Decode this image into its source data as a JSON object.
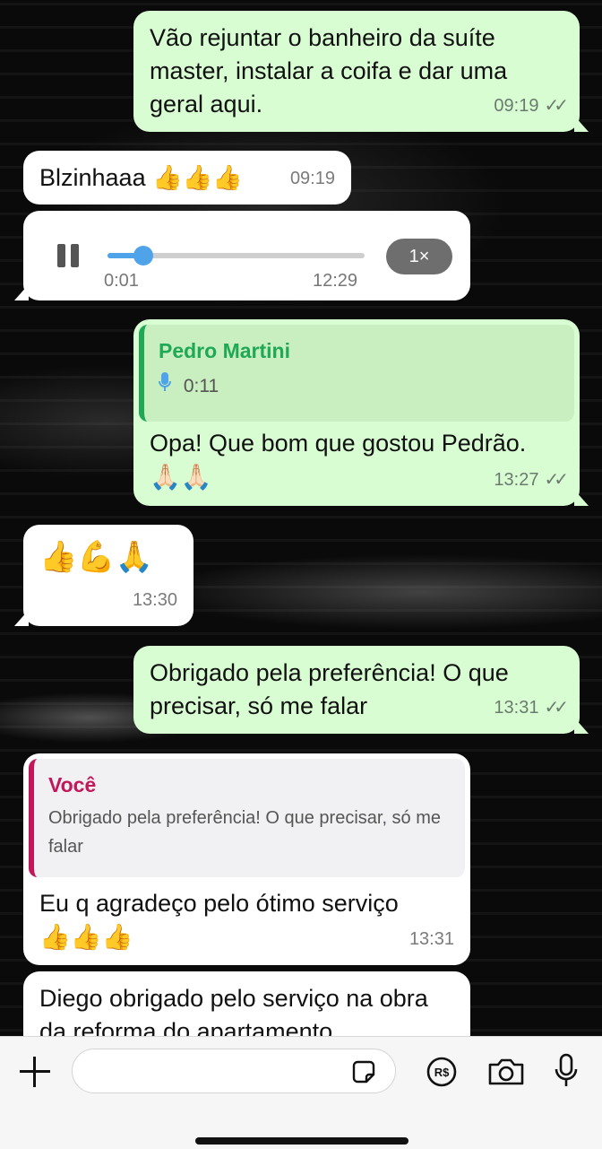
{
  "messages": {
    "m1": {
      "text": "Vão rejuntar o banheiro da suíte master, instalar a coifa e dar uma geral aqui.",
      "time": "09:19"
    },
    "m2": {
      "text": "Blzinhaaa 👍👍👍",
      "time": "09:19"
    },
    "m3": {
      "current": "0:01",
      "duration": "12:29",
      "speed": "1×",
      "progress": 0.14
    },
    "m4": {
      "quote_name": "Pedro Martini",
      "quote_duration": "0:11",
      "text": "Opa! Que bom que gostou Pedrão.",
      "emoji": "🙏🏻🙏🏻",
      "time": "13:27"
    },
    "m5": {
      "emoji": "👍💪🙏",
      "time": "13:30"
    },
    "m6": {
      "text": "Obrigado pela preferência! O que precisar, só me falar",
      "time": "13:31"
    },
    "m7": {
      "quote_name": "Você",
      "quote_text": "Obrigado pela preferência! O que precisar, só me falar",
      "text": "Eu q agradeço pelo ótimo serviço",
      "emoji": "👍👍👍",
      "time": "13:31"
    },
    "m8": {
      "text": "Diego obrigado pelo serviço na obra da reforma do apartamento"
    }
  },
  "colors": {
    "outgoing_bubble": "#d9fdd3",
    "incoming_bubble": "#ffffff",
    "quote_green": "#1fa855",
    "quote_pink": "#c2185b",
    "mic_blue": "#4fa3e8"
  },
  "icons": {
    "read_ticks": "double-check-icon",
    "pause": "pause-icon",
    "mic": "mic-icon",
    "add": "plus-icon",
    "sticker": "sticker-icon",
    "payment": "payment-icon",
    "camera": "camera-icon"
  }
}
